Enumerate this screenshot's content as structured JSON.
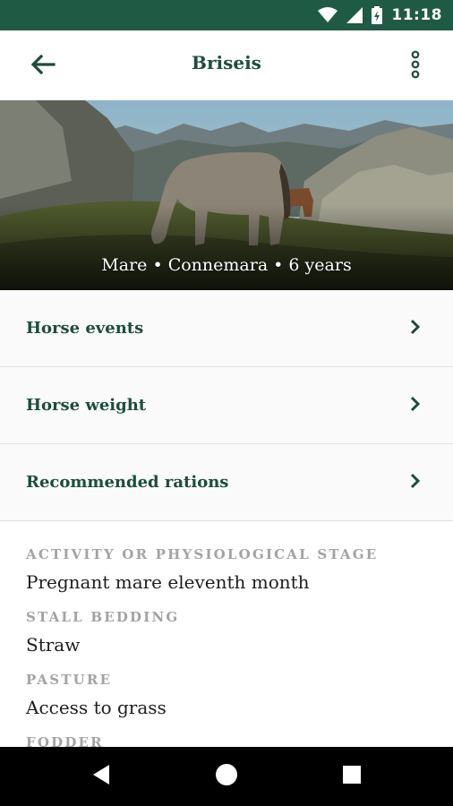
{
  "status_bar": {
    "time": "11:18",
    "icons": [
      "wifi-icon",
      "cellular-signal-icon",
      "battery-icon"
    ]
  },
  "app_bar": {
    "title": "Briseis",
    "back_icon": "arrow-left-icon",
    "menu_icon": "more-vertical-icon"
  },
  "hero": {
    "caption": "Mare • Connemara • 6 years",
    "image": "horse-grazing-mountain-photo"
  },
  "menu": {
    "items": [
      {
        "label": "Horse events"
      },
      {
        "label": "Horse weight"
      },
      {
        "label": "Recommended rations"
      }
    ]
  },
  "details": {
    "activity_label": "ACTIVITY OR PHYSIOLOGICAL STAGE",
    "activity_value": "Pregnant mare eleventh month",
    "bedding_label": "STALL BEDDING",
    "bedding_value": "Straw",
    "pasture_label": "PASTURE",
    "pasture_value": "Access to grass",
    "fodder_label": "FODDER"
  },
  "nav_bar": {
    "icons": [
      "back-triangle-icon",
      "home-circle-icon",
      "recents-square-icon"
    ]
  },
  "colors": {
    "status_bar": "#1f5a45",
    "primary_text": "#1c4d3c",
    "label_gray": "#a3a3a3"
  }
}
